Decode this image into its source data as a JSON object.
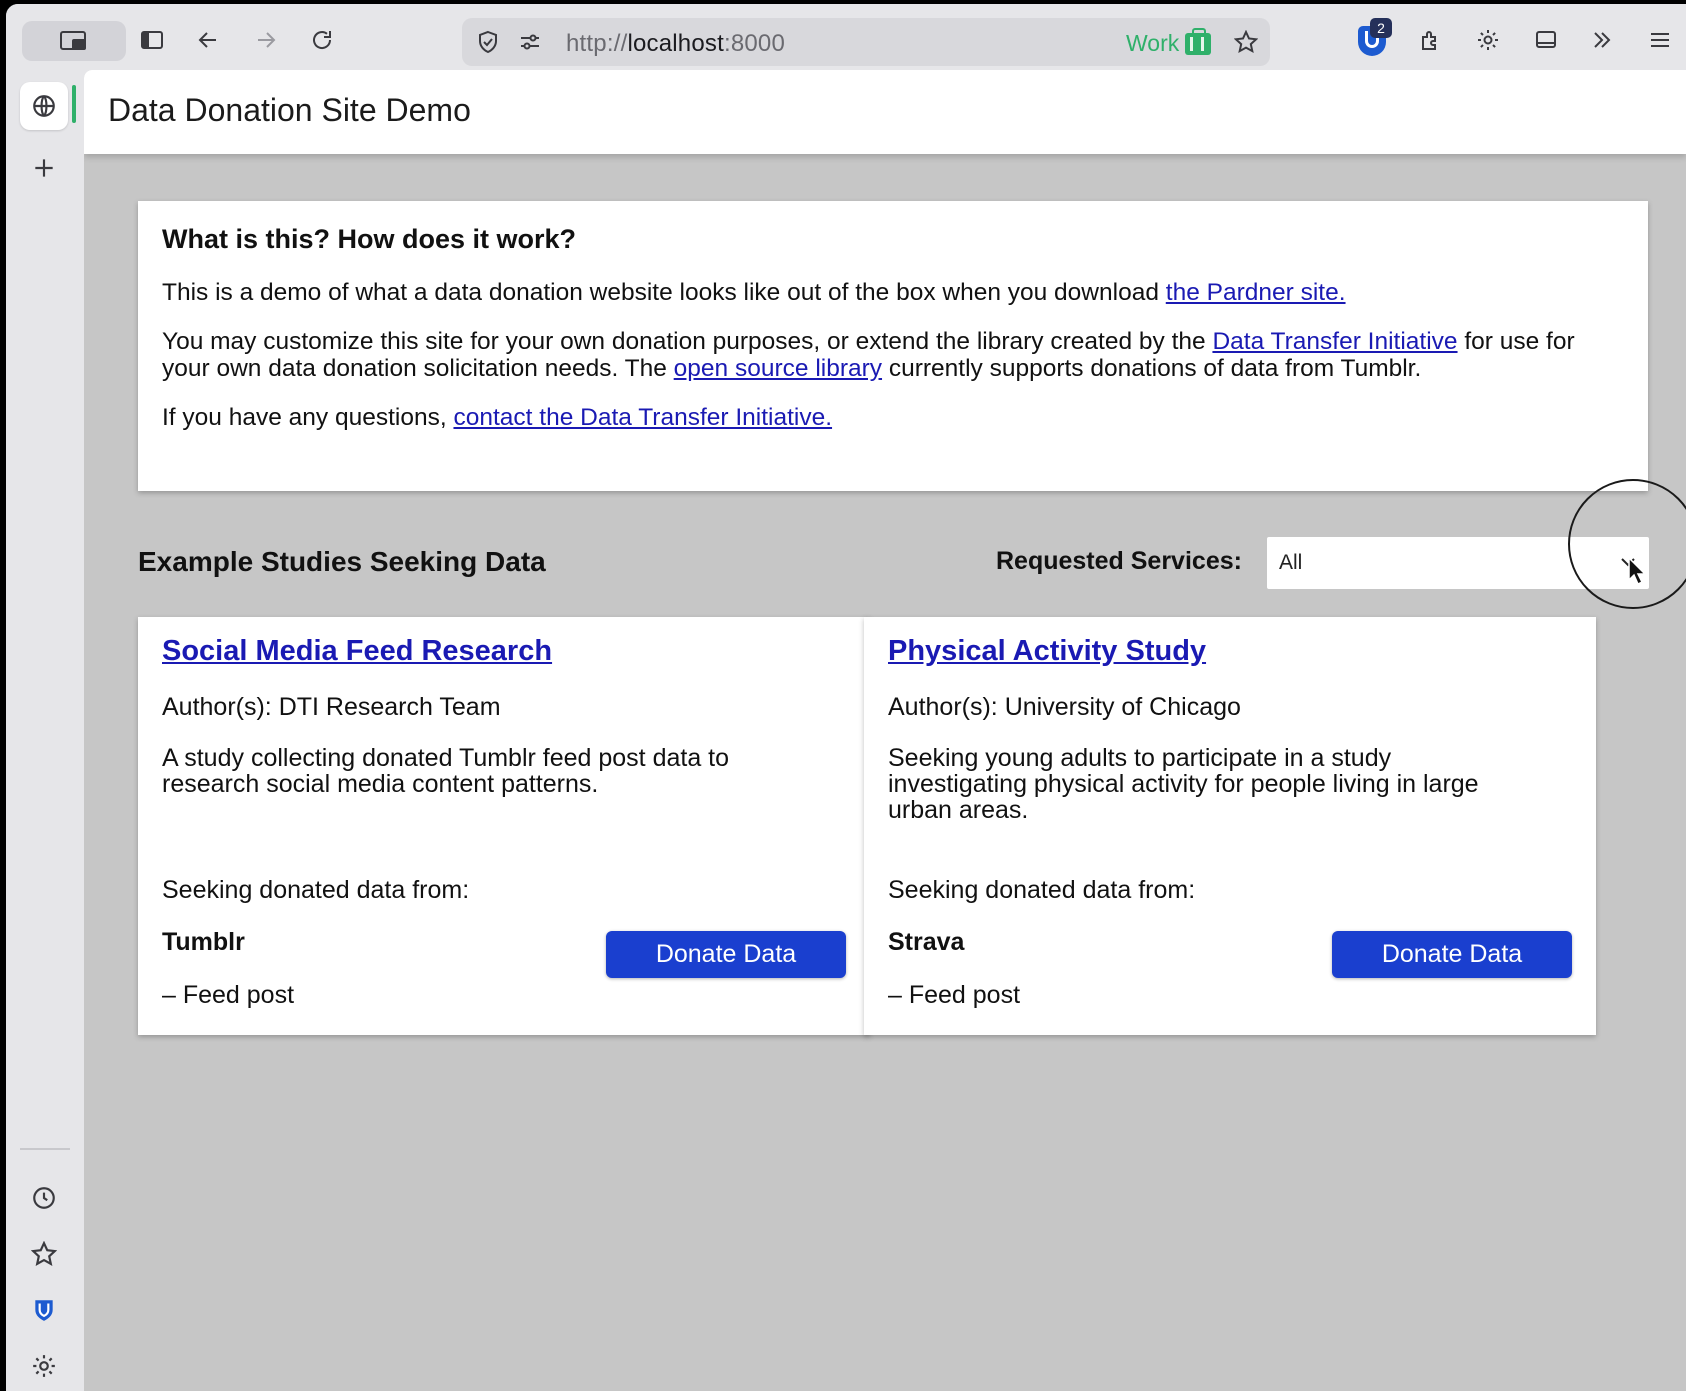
{
  "browser": {
    "url_scheme": "http://",
    "url_host": "localhost",
    "url_port": ":8000",
    "container_label": "Work",
    "container_color": "#2fb06a",
    "extension_badge_count": "2",
    "icons": [
      "tabs-icon",
      "sidebar-toggle-icon",
      "back-icon",
      "forward-icon",
      "reload-icon",
      "shield-icon",
      "permissions-icon",
      "bookmark-star-icon",
      "bitwarden-icon",
      "extensions-icon",
      "gear-icon",
      "screen-icon",
      "overflow-icon",
      "menu-icon"
    ]
  },
  "sidebar": {
    "icons": [
      "globe-icon",
      "plus-icon",
      "history-icon",
      "bookmarks-icon",
      "bitwarden-icon",
      "settings-icon"
    ]
  },
  "site": {
    "title": "Data Donation Site Demo"
  },
  "info": {
    "heading": "What is this? How does it work?",
    "p1_text": "This is a demo of what a data donation website looks like out of the box when you download ",
    "p1_link": "the Pardner site.",
    "p2_text_a": "You may customize this site for your own donation purposes, or extend the library created by the ",
    "p2_link_a": "Data Transfer Initiative",
    "p2_text_b": " for use for your own data donation solicitation needs. The ",
    "p2_link_b": "open source library",
    "p2_text_c": " currently supports donations of data from Tumblr.",
    "p3_text": "If you have any questions, ",
    "p3_link": "contact the Data Transfer Initiative."
  },
  "studies": {
    "heading": "Example Studies Seeking Data",
    "filter_label": "Requested Services:",
    "filter_value": "All",
    "cards": [
      {
        "title": "Social Media Feed Research",
        "author": "Author(s): DTI Research Team",
        "description": "A study collecting donated Tumblr feed post data to research social media content patterns.",
        "seeking": "Seeking donated data from:",
        "service": "Tumblr",
        "data_type": "– Feed post",
        "button": "Donate Data"
      },
      {
        "title": "Physical Activity Study",
        "author": "Author(s): University of Chicago",
        "description": "Seeking young adults to participate in a study investigating physical activity for people living in large urban areas.",
        "seeking": "Seeking donated data from:",
        "service": "Strava",
        "data_type": "– Feed post",
        "button": "Donate Data"
      }
    ]
  },
  "colors": {
    "link": "#1a1ab3",
    "button": "#1a3fcf",
    "page_background": "#c6c6c6"
  }
}
